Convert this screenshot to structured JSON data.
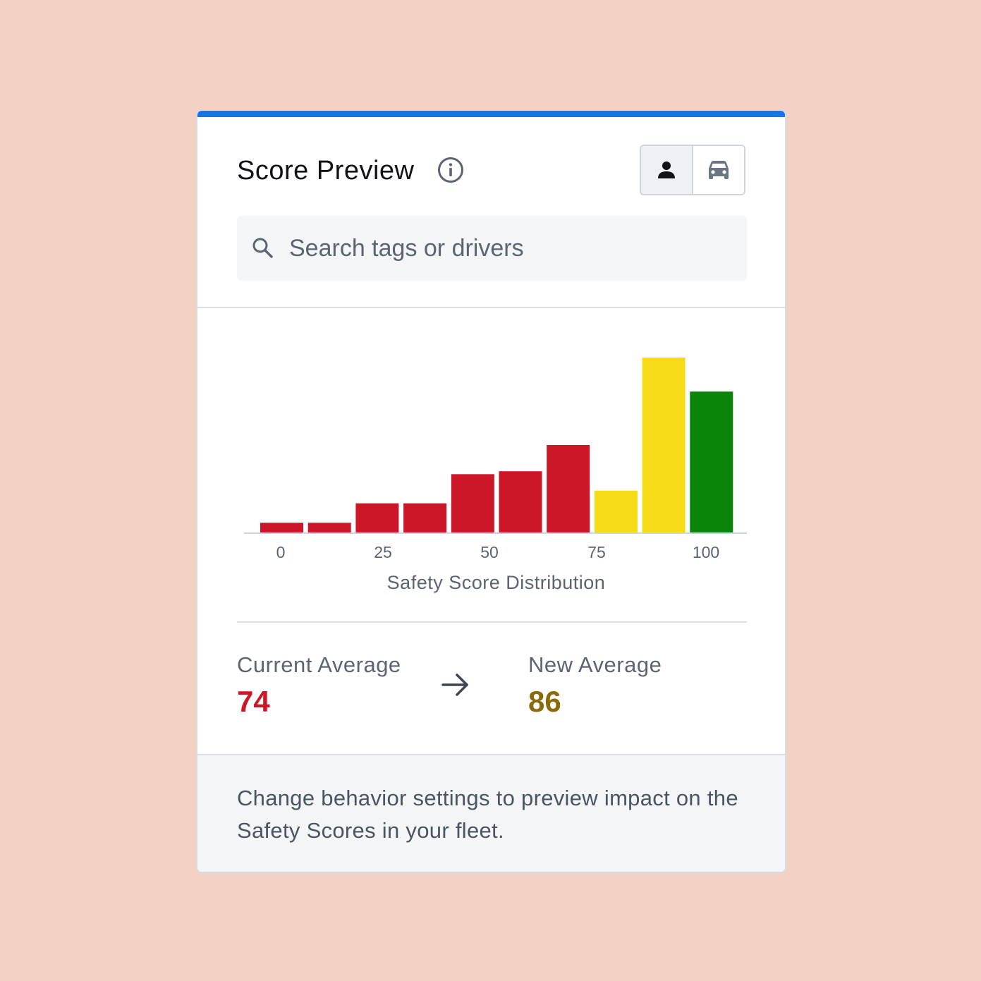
{
  "card": {
    "title": "Score Preview",
    "accent_color": "#1a73e8",
    "info_icon": "info-circle-icon",
    "toggle": [
      {
        "icon": "person-icon",
        "active": true
      },
      {
        "icon": "car-icon",
        "active": false
      }
    ]
  },
  "search": {
    "icon": "search-icon",
    "placeholder": "Search tags or drivers"
  },
  "chart_data": {
    "type": "bar",
    "title": "",
    "xlabel": "Safety Score Distribution",
    "ylabel": "",
    "x_ticks": [
      "0",
      "25",
      "50",
      "75",
      "100"
    ],
    "grid": false,
    "legend": "none",
    "bins": [
      {
        "value": 1,
        "color": "#cc1728"
      },
      {
        "value": 1,
        "color": "#cc1728"
      },
      {
        "value": 3,
        "color": "#cc1728"
      },
      {
        "value": 3,
        "color": "#cc1728"
      },
      {
        "value": 6,
        "color": "#cc1728"
      },
      {
        "value": 6.3,
        "color": "#cc1728"
      },
      {
        "value": 9,
        "color": "#cc1728"
      },
      {
        "value": 4.3,
        "color": "#f5dc17"
      },
      {
        "value": 18,
        "color": "#f5dc17"
      },
      {
        "value": 14.5,
        "color": "#0a850a"
      }
    ],
    "ylim": [
      0,
      18
    ]
  },
  "stats": {
    "current": {
      "label": "Current Average",
      "value": "74",
      "color": "#cc1728"
    },
    "arrow_icon": "arrow-right-icon",
    "new": {
      "label": "New Average",
      "value": "86",
      "color": "#8a6a0a"
    }
  },
  "footer": {
    "text": "Change behavior settings to preview impact on the Safety Scores in your fleet."
  }
}
